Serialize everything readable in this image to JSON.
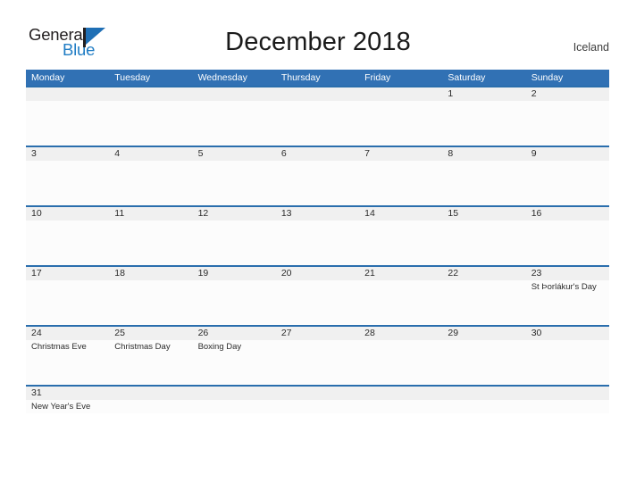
{
  "brand": {
    "name_part1": "General",
    "name_part2": "Blue",
    "flag_color": "#1f6fb5"
  },
  "header": {
    "title": "December 2018",
    "country": "Iceland"
  },
  "theme": {
    "header_blue": "#3171b4",
    "rule_blue": "#2a6ead",
    "date_strip_gray": "#f0f0f0",
    "cell_white": "#fcfcfc"
  },
  "calendar": {
    "weekday_headers": [
      "Monday",
      "Tuesday",
      "Wednesday",
      "Thursday",
      "Friday",
      "Saturday",
      "Sunday"
    ],
    "weeks": [
      {
        "days": [
          {
            "num": "",
            "event": ""
          },
          {
            "num": "",
            "event": ""
          },
          {
            "num": "",
            "event": ""
          },
          {
            "num": "",
            "event": ""
          },
          {
            "num": "",
            "event": ""
          },
          {
            "num": "1",
            "event": ""
          },
          {
            "num": "2",
            "event": ""
          }
        ]
      },
      {
        "days": [
          {
            "num": "3",
            "event": ""
          },
          {
            "num": "4",
            "event": ""
          },
          {
            "num": "5",
            "event": ""
          },
          {
            "num": "6",
            "event": ""
          },
          {
            "num": "7",
            "event": ""
          },
          {
            "num": "8",
            "event": ""
          },
          {
            "num": "9",
            "event": ""
          }
        ]
      },
      {
        "days": [
          {
            "num": "10",
            "event": ""
          },
          {
            "num": "11",
            "event": ""
          },
          {
            "num": "12",
            "event": ""
          },
          {
            "num": "13",
            "event": ""
          },
          {
            "num": "14",
            "event": ""
          },
          {
            "num": "15",
            "event": ""
          },
          {
            "num": "16",
            "event": ""
          }
        ]
      },
      {
        "days": [
          {
            "num": "17",
            "event": ""
          },
          {
            "num": "18",
            "event": ""
          },
          {
            "num": "19",
            "event": ""
          },
          {
            "num": "20",
            "event": ""
          },
          {
            "num": "21",
            "event": ""
          },
          {
            "num": "22",
            "event": ""
          },
          {
            "num": "23",
            "event": "St Þorlákur's Day"
          }
        ]
      },
      {
        "days": [
          {
            "num": "24",
            "event": "Christmas Eve"
          },
          {
            "num": "25",
            "event": "Christmas Day"
          },
          {
            "num": "26",
            "event": "Boxing Day"
          },
          {
            "num": "27",
            "event": ""
          },
          {
            "num": "28",
            "event": ""
          },
          {
            "num": "29",
            "event": ""
          },
          {
            "num": "30",
            "event": ""
          }
        ]
      },
      {
        "days": [
          {
            "num": "31",
            "event": "New Year's Eve"
          },
          {
            "num": "",
            "event": ""
          },
          {
            "num": "",
            "event": ""
          },
          {
            "num": "",
            "event": ""
          },
          {
            "num": "",
            "event": ""
          },
          {
            "num": "",
            "event": ""
          },
          {
            "num": "",
            "event": ""
          }
        ]
      }
    ]
  }
}
